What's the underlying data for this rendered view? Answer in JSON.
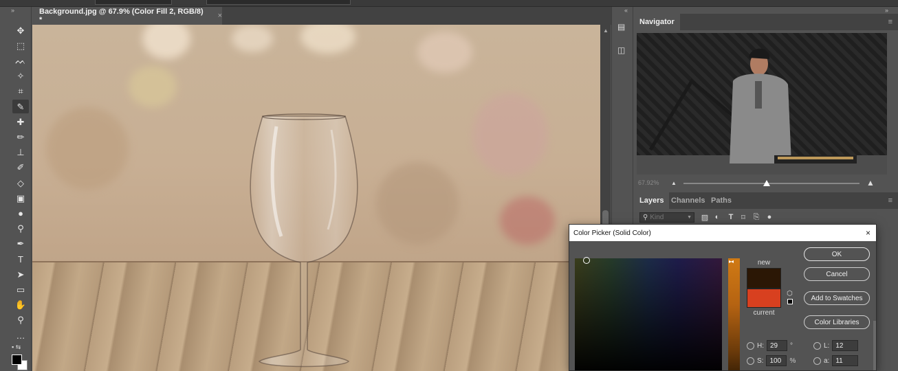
{
  "document": {
    "tab_title": "Background.jpg @ 67.9% (Color Fill 2, RGB/8) *",
    "tab_close": "×"
  },
  "toolbar": {
    "collapse": "»",
    "tools": [
      {
        "name": "move-tool-icon",
        "glyph": "✥"
      },
      {
        "name": "marquee-tool-icon",
        "glyph": "⬚"
      },
      {
        "name": "lasso-tool-icon",
        "glyph": "ᨓ"
      },
      {
        "name": "magic-wand-tool-icon",
        "glyph": "✧"
      },
      {
        "name": "crop-tool-icon",
        "glyph": "⌗"
      },
      {
        "name": "eyedropper-tool-icon",
        "glyph": "✎"
      },
      {
        "name": "healing-brush-tool-icon",
        "glyph": "✚"
      },
      {
        "name": "brush-tool-icon",
        "glyph": "✏"
      },
      {
        "name": "stamp-tool-icon",
        "glyph": "⊥"
      },
      {
        "name": "history-brush-tool-icon",
        "glyph": "✐"
      },
      {
        "name": "eraser-tool-icon",
        "glyph": "◇"
      },
      {
        "name": "gradient-tool-icon",
        "glyph": "▣"
      },
      {
        "name": "blur-tool-icon",
        "glyph": "●"
      },
      {
        "name": "dodge-tool-icon",
        "glyph": "⚲"
      },
      {
        "name": "pen-tool-icon",
        "glyph": "✒"
      },
      {
        "name": "type-tool-icon",
        "glyph": "T"
      },
      {
        "name": "path-selection-tool-icon",
        "glyph": "➤"
      },
      {
        "name": "rectangle-tool-icon",
        "glyph": "▭"
      },
      {
        "name": "hand-tool-icon",
        "glyph": "✋"
      },
      {
        "name": "zoom-tool-icon",
        "glyph": "⚲"
      },
      {
        "name": "more-tools-icon",
        "glyph": "…"
      }
    ]
  },
  "iconstrip": {
    "collapse": "«"
  },
  "panels": {
    "collapse": "»",
    "navigator": {
      "tab": "Navigator",
      "menu": "≡",
      "zoom": "67.92%"
    },
    "layers": {
      "tabs": [
        "Layers",
        "Channels",
        "Paths"
      ],
      "menu": "≡",
      "filter_kind": "Kind"
    }
  },
  "color_picker": {
    "title": "Color Picker (Solid Color)",
    "close": "×",
    "new_label": "new",
    "current_label": "current",
    "new_color": "#2b1705",
    "current_color": "#d8401f",
    "buttons": {
      "ok": "OK",
      "cancel": "Cancel",
      "add_to_swatches": "Add to Swatches",
      "color_libraries": "Color Libraries"
    },
    "fields": {
      "h_label": "H:",
      "h_value": "29",
      "h_unit": "°",
      "s_label": "S:",
      "s_value": "100",
      "s_unit": "%",
      "l_label": "L:",
      "l_value": "12",
      "a_label": "a:",
      "a_value": "11"
    }
  }
}
